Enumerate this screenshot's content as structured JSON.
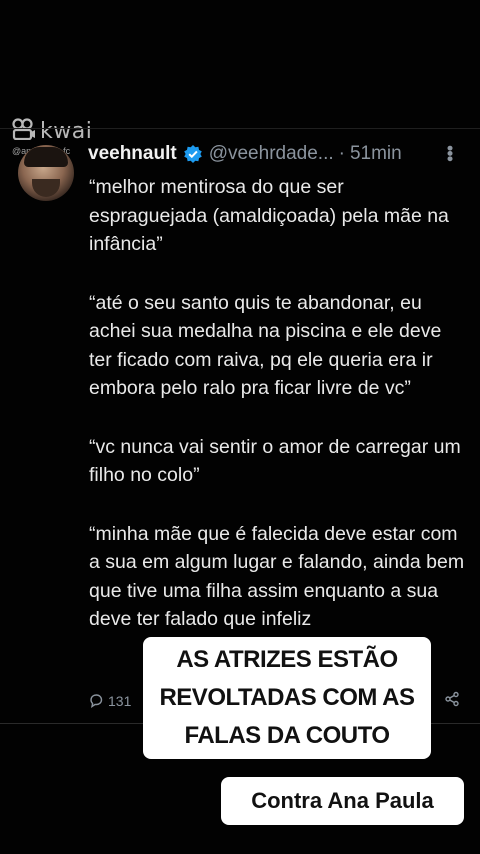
{
  "watermark": {
    "brand": "kwai",
    "handle": "@anapaula_fc"
  },
  "tweet": {
    "display_name": "veehnault",
    "handle": "@veehrdade...",
    "separator": "·",
    "timestamp": "51min",
    "paragraphs": [
      "“melhor mentirosa do que ser espraguejada (amaldiçoada) pela mãe na infância”",
      "“até o seu santo quis te abandonar, eu achei sua medalha na piscina e ele deve ter ficado com raiva, pq ele queria era ir embora pelo ralo pra ficar livre de vc”",
      "“vc nunca vai sentir o amor de carregar um filho no colo”",
      "“minha mãe que é falecida deve estar com a sua em algum lugar e falando, ainda bem que tive uma filha assim enquanto a sua deve ter falado que infeliz"
    ],
    "reply_count": "131"
  },
  "overlays": {
    "main_caption": "AS ATRIZES ESTÃO REVOLTADAS COM AS FALAS DA COUTO",
    "sub_caption": "Contra Ana Paula"
  },
  "colors": {
    "background": "#020202",
    "text": "#e9e9e9",
    "muted": "#8b949e",
    "verified": "#1d9bf0",
    "overlay_bg": "#ffffff"
  }
}
